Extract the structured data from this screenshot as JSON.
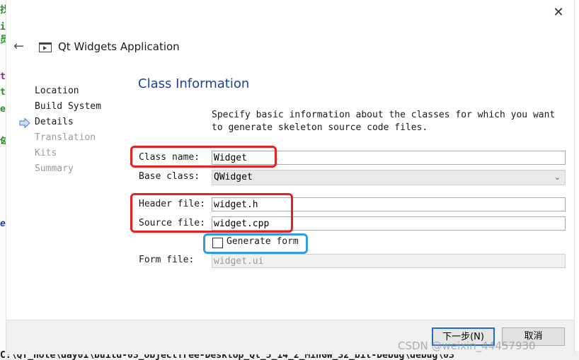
{
  "window": {
    "title": "Qt Widgets Application",
    "close_glyph": "✕",
    "back_glyph": "←"
  },
  "sidebar": {
    "items": [
      {
        "label": "Location",
        "state": "done"
      },
      {
        "label": "Build System",
        "state": "done"
      },
      {
        "label": "Details",
        "state": "current"
      },
      {
        "label": "Translation",
        "state": "disabled"
      },
      {
        "label": "Kits",
        "state": "disabled"
      },
      {
        "label": "Summary",
        "state": "disabled"
      }
    ]
  },
  "page": {
    "heading": "Class Information",
    "description_line1": "Specify basic information about the classes for which you want",
    "description_line2": "to generate skeleton source code files."
  },
  "form": {
    "class_name_label": "Class name:",
    "class_name_value": "Widget",
    "base_class_label": "Base class:",
    "base_class_value": "QWidget",
    "header_file_label": "Header file:",
    "header_file_value": "widget.h",
    "source_file_label": "Source file:",
    "source_file_value": "widget.cpp",
    "generate_form_label": "Generate form",
    "generate_form_checked": false,
    "form_file_label": "Form file:",
    "form_file_value": "widget.ui"
  },
  "buttons": {
    "next": "下一步(N)",
    "cancel": "取消"
  },
  "background": {
    "left_glyphs": [
      "找",
      "i",
      "员",
      "t",
      "t",
      "e",
      "匈",
      "e"
    ],
    "bottom_path": "C:\\QT_note\\day01\\build-03_objectTree-Desktop_Qt_5_14_2_MinGW_32_bit-Debug\\debug\\03"
  },
  "watermark": "CSDN @weixin_44457930",
  "colors": {
    "heading": "#1f3f9c",
    "highlight_red": "#e8211f",
    "highlight_blue": "#2f9de0",
    "default_button_border": "#1e6fc8"
  }
}
